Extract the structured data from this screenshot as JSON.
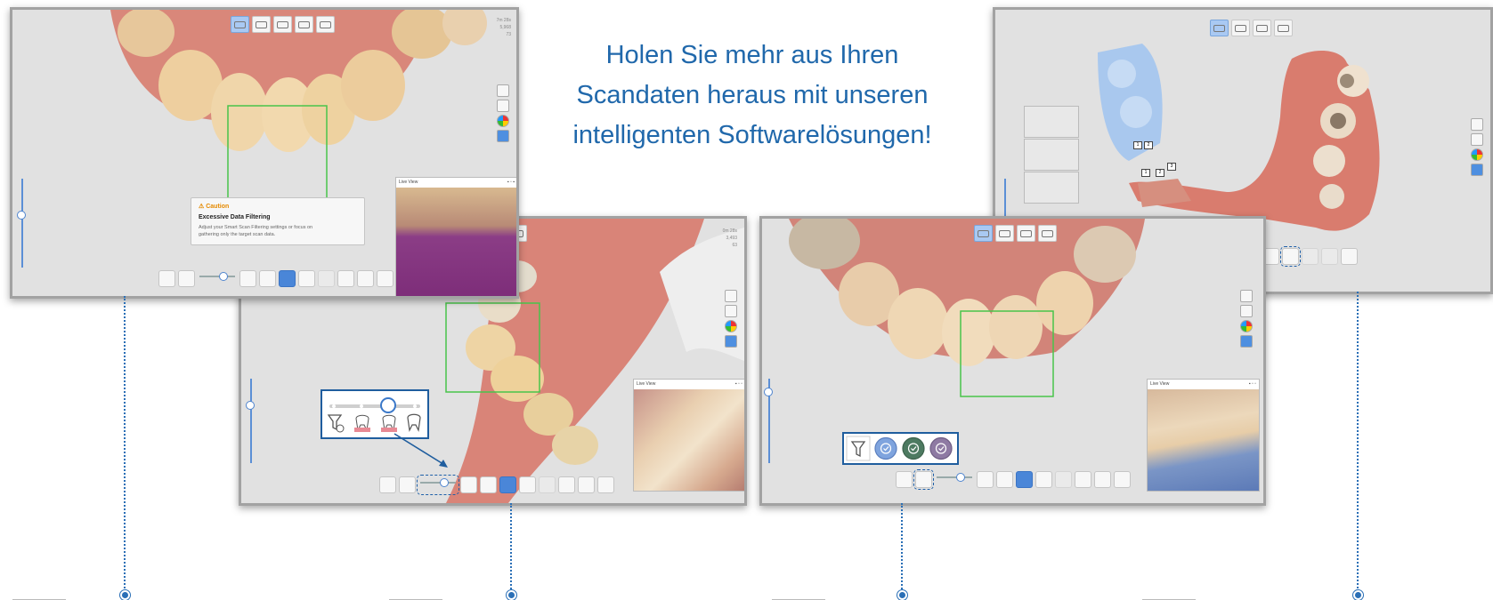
{
  "headline": {
    "line1": "Holen Sie mehr aus Ihren",
    "line2": "Scandaten heraus mit unseren",
    "line3": "intelligenten Softwarelösungen!"
  },
  "colors": {
    "accent": "#2068ab",
    "connector": "#2a6fb6",
    "scan_box": "#49c44a",
    "caution": "#e58a00",
    "window_bg": "#e1e1e1",
    "active_tool": "#4a86d8"
  },
  "screen1": {
    "meta": {
      "line1": "7m 28s",
      "line2": "5,968",
      "line3": "73"
    },
    "caution": {
      "title": "Caution",
      "heading": "Excessive Data Filtering",
      "body_line1": "Adjust your Smart Scan Filtering settings or focus on",
      "body_line2": "gathering only the target scan data."
    },
    "live_view": {
      "title": "Live View"
    }
  },
  "screen2": {
    "meta": {
      "line1": "0m 28s",
      "line2": "3,493",
      "line3": "63"
    },
    "live_view": {
      "title": "Live View"
    },
    "callout": {
      "icons": [
        "filter-off-icon",
        "tooth-gingiva-icon",
        "tooth-gingiva-icon",
        "tooth-outline-icon"
      ]
    }
  },
  "screen3": {
    "live_view": {
      "title": "Live View"
    },
    "callout": {
      "icons": [
        "filter-icon",
        "check-blue-icon",
        "check-green-icon",
        "check-purple-icon"
      ]
    }
  },
  "screen4": {
    "markers": [
      "1",
      "2",
      "1",
      "2",
      "3"
    ]
  }
}
